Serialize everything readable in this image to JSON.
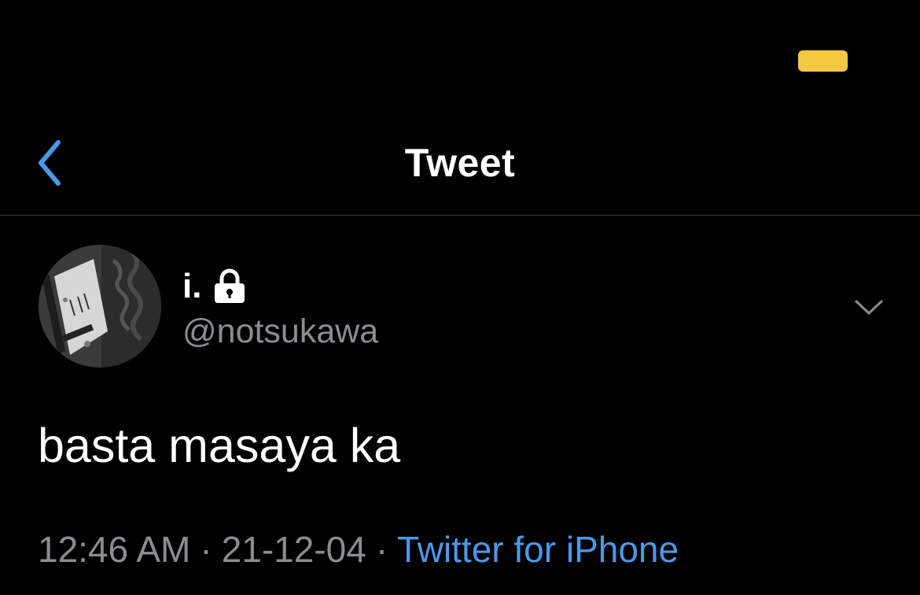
{
  "status_bar": {
    "battery_color": "#f5c842"
  },
  "nav": {
    "back_icon": "chevron-left-icon",
    "title": "Tweet"
  },
  "tweet": {
    "author": {
      "display_name": "i.",
      "protected_icon": "lock-icon",
      "handle": "@notsukawa"
    },
    "more_icon": "chevron-down-icon",
    "text": "basta masaya ka",
    "meta": {
      "time": "12:46 AM",
      "separator": "·",
      "date": "21-12-04",
      "source": "Twitter for iPhone"
    }
  },
  "colors": {
    "background": "#000000",
    "accent": "#4a99e9",
    "secondary_text": "#8a8d91",
    "divider": "#3a3a3c"
  }
}
